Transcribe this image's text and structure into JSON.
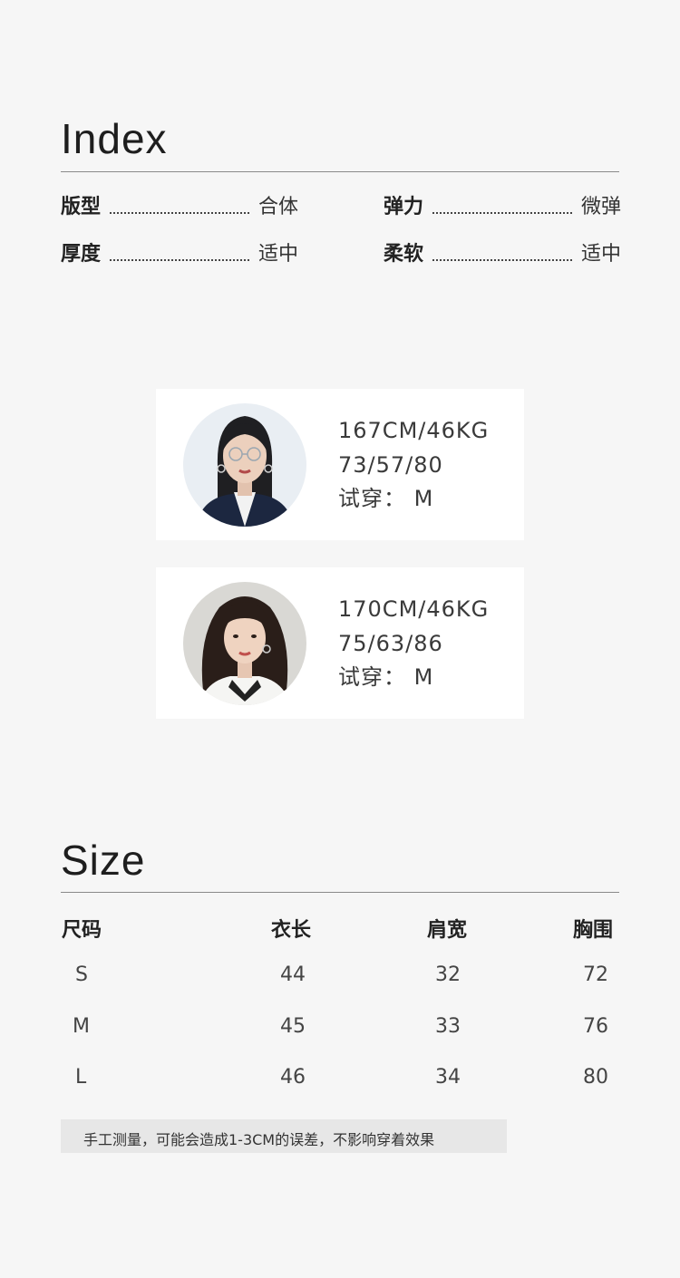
{
  "index": {
    "title": "Index",
    "rows": [
      [
        {
          "key": "版型",
          "value": "合体"
        },
        {
          "key": "弹力",
          "value": "微弹"
        }
      ],
      [
        {
          "key": "厚度",
          "value": "适中"
        },
        {
          "key": "柔软",
          "value": "适中"
        }
      ]
    ]
  },
  "models": [
    {
      "line1": "167CM/46KG",
      "line2": "73/57/80",
      "line3": "试穿：  M"
    },
    {
      "line1": "170CM/46KG",
      "line2": "75/63/86",
      "line3": "试穿：  M"
    }
  ],
  "size": {
    "title": "Size",
    "headers": [
      "尺码",
      "衣长",
      "肩宽",
      "胸围"
    ],
    "rows": [
      [
        "S",
        "44",
        "32",
        "72"
      ],
      [
        "M",
        "45",
        "33",
        "76"
      ],
      [
        "L",
        "46",
        "34",
        "80"
      ]
    ],
    "note": "手工测量，可能会造成1-3CM的误差，不影响穿着效果"
  }
}
